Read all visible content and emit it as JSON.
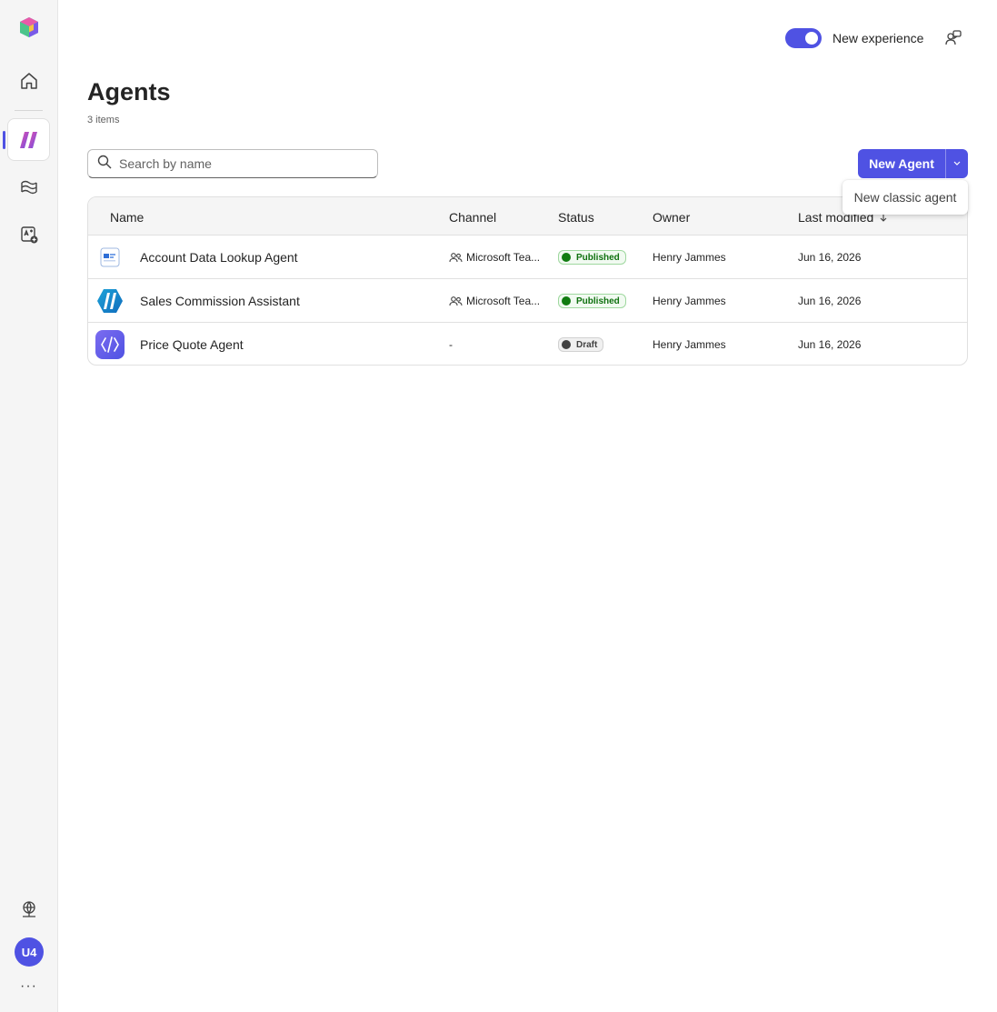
{
  "topbar": {
    "toggle_label": "New experience",
    "toggle_on": true
  },
  "page": {
    "title": "Agents",
    "count": "3 items"
  },
  "search": {
    "placeholder": "Search by name",
    "value": ""
  },
  "actions": {
    "new_agent_label": "New Agent",
    "menu_items": [
      "New classic agent"
    ]
  },
  "table": {
    "columns": [
      "Name",
      "Channel",
      "Status",
      "Owner",
      "Last modified"
    ],
    "rows": [
      {
        "icon": "document-agent-icon",
        "name": "Account Data Lookup Agent",
        "channel": "Microsoft Tea...",
        "status": "Published",
        "owner": "Henry Jammes",
        "modified": "Jun 16, 2026"
      },
      {
        "icon": "slash-hexagon-icon",
        "name": "Sales Commission Assistant",
        "channel": "Microsoft Tea...",
        "status": "Published",
        "owner": "Henry Jammes",
        "modified": "Jun 16, 2026"
      },
      {
        "icon": "code-agent-icon",
        "name": "Price Quote Agent",
        "channel": "-",
        "status": "Draft",
        "owner": "Henry Jammes",
        "modified": "Jun 16, 2026"
      }
    ]
  },
  "user": {
    "initials": "U4"
  },
  "colors": {
    "accent": "#4f52e3",
    "published": "#107c10",
    "draft": "#424242"
  }
}
